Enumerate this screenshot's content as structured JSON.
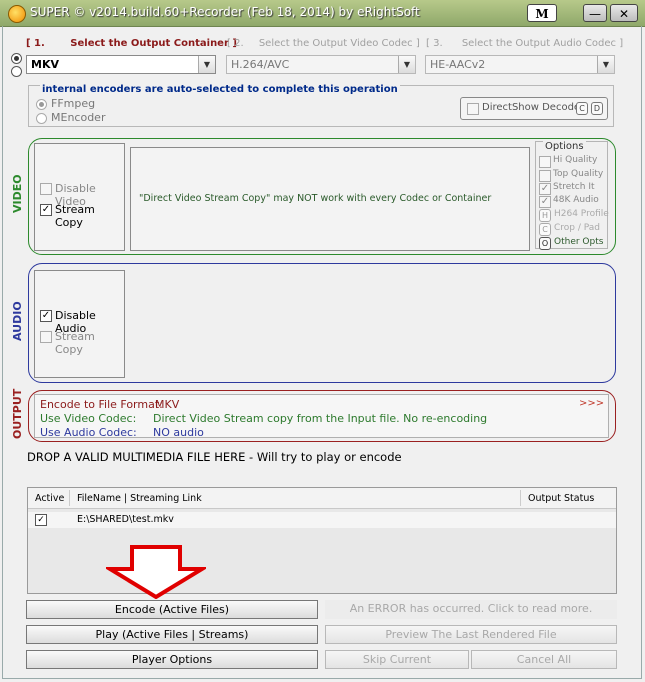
{
  "window": {
    "title": "SUPER © v2014.build.60+Recorder (Feb 18, 2014) by eRightSoft",
    "m_button": "M",
    "minimize_label": "—",
    "close_label": "✕"
  },
  "steps": {
    "step1_num": "[ 1.",
    "step1_label": "Select the Output Container ]",
    "step2_num": "[ 2.",
    "step2_label": "Select the Output Video Codec ]",
    "step3_num": "[ 3.",
    "step3_label": "Select the Output Audio Codec ]"
  },
  "selects": {
    "container": "MKV",
    "video_codec": "H.264/AVC",
    "audio_codec": "HE-AACv2"
  },
  "encoders": {
    "note": "internal encoders are auto-selected to complete this operation",
    "ffmpeg": "FFmpeg",
    "mencoder": "MEncoder",
    "directshow": "DirectShow Decode",
    "mini_c": "C",
    "mini_d": "D"
  },
  "video": {
    "section_label": "VIDEO",
    "disable_video": "Disable Video",
    "stream_copy": "Stream Copy",
    "message": "\"Direct Video Stream Copy\" may NOT work with every Codec or Container",
    "options_title": "Options",
    "options": {
      "hi_quality": "Hi Quality",
      "top_quality": "Top Quality",
      "stretch_it": "Stretch It",
      "k48_audio": "48K Audio",
      "h264_profile": "H264 Profile",
      "crop_pad": "Crop / Pad",
      "other_opts": "Other Opts",
      "btn_h": "H",
      "btn_c": "C",
      "btn_o": "O"
    }
  },
  "audio": {
    "section_label": "AUDIO",
    "disable_audio": "Disable Audio",
    "stream_copy": "Stream Copy"
  },
  "output": {
    "section_label": "OUTPUT",
    "format_label": "Encode to File Format:",
    "format_value": "MKV",
    "video_label": "Use Video Codec:",
    "video_value": "Direct Video Stream copy from the Input file. No re-encoding",
    "audio_label": "Use Audio Codec:",
    "audio_value": "NO audio",
    "more": ">>>"
  },
  "drop_text": "DROP A VALID MULTIMEDIA FILE HERE - Will try to play or encode",
  "files": {
    "col_active": "Active",
    "col_filename": "FileName  |  Streaming Link",
    "col_status": "Output Status",
    "rows": [
      {
        "path": "E:\\SHARED\\test.mkv",
        "status": ""
      }
    ]
  },
  "buttons": {
    "encode": "Encode (Active Files)",
    "error": "An ERROR has occurred. Click to read more.",
    "play": "Play (Active Files | Streams)",
    "preview": "Preview The Last Rendered File",
    "player_options": "Player Options",
    "skip": "Skip Current",
    "cancel_all": "Cancel All"
  },
  "colors": {
    "video": "#2d8a2d",
    "audio": "#2e3a9e",
    "output": "#9a2020",
    "arrow": "#e00000"
  }
}
